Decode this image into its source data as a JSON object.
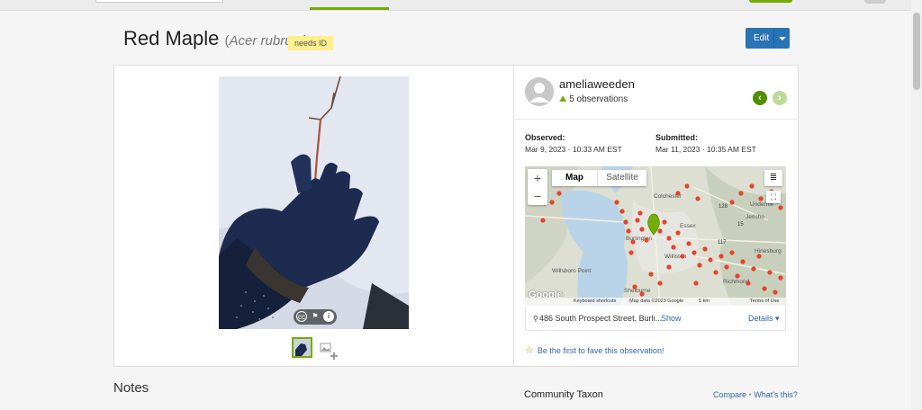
{
  "observation": {
    "common_name": "Red Maple",
    "scientific_name": "Acer rubrum",
    "quality_badge": "needs ID",
    "edit_label": "Edit"
  },
  "user": {
    "name": "ameliaweeden",
    "observations": "5 observations"
  },
  "dates": {
    "observed_label": "Observed:",
    "observed_value": "Mar 9, 2023 · 10:33 AM EST",
    "submitted_label": "Submitted:",
    "submitted_value": "Mar 11, 2023 · 10:35 AM EST"
  },
  "map": {
    "map_tab": "Map",
    "satellite_tab": "Satellite",
    "zoom_in": "+",
    "zoom_out": "−",
    "google": "Google",
    "keyboard_shortcuts": "Keyboard shortcuts",
    "map_data": "Map data ©2023 Google",
    "scale": "5 km",
    "terms": "Terms of Use",
    "places": [
      "Colchester",
      "Essex",
      "Williston",
      "Richmond",
      "Willsboro Point",
      "Shelburne",
      "Jericho",
      "Underhill",
      "Hinesburg",
      "Burlington"
    ],
    "roads": [
      "117",
      "128",
      "15"
    ]
  },
  "location": {
    "address": "486 South Prospect Street, Burli...",
    "show_link": "Show",
    "details_link": "Details"
  },
  "fave": {
    "text": "Be the first to fave this observation!"
  },
  "sections": {
    "notes": "Notes",
    "community_taxon": "Community Taxon",
    "compare": "Compare",
    "bullet": "•",
    "whats_this": "What's this?"
  },
  "colors": {
    "brand_green": "#74ac00",
    "edit_blue": "#2973b7",
    "needs_id_yellow": "#fdf08c",
    "link_blue": "#3366aa",
    "marker_red": "#e8422b"
  }
}
